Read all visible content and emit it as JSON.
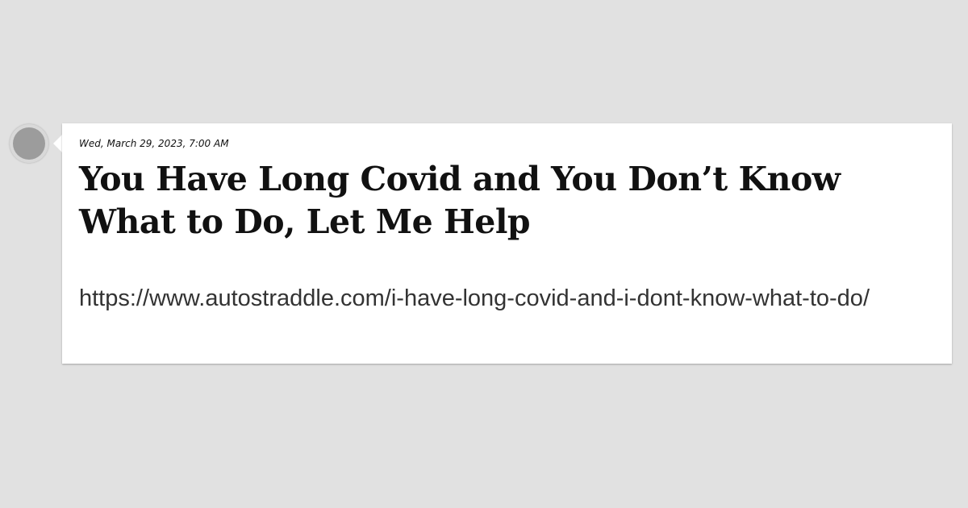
{
  "post": {
    "timestamp": "Wed, March 29, 2023, 7:00 AM",
    "title": "You Have Long Covid and You Don’t Know What to Do, Let Me Help",
    "url": "https://www.autostraddle.com/i-have-long-covid-and-i-dont-know-what-to-do/"
  },
  "colors": {
    "background": "#e1e1e1",
    "card": "#ffffff",
    "avatar": "#9c9c9c",
    "text": "#111111"
  }
}
